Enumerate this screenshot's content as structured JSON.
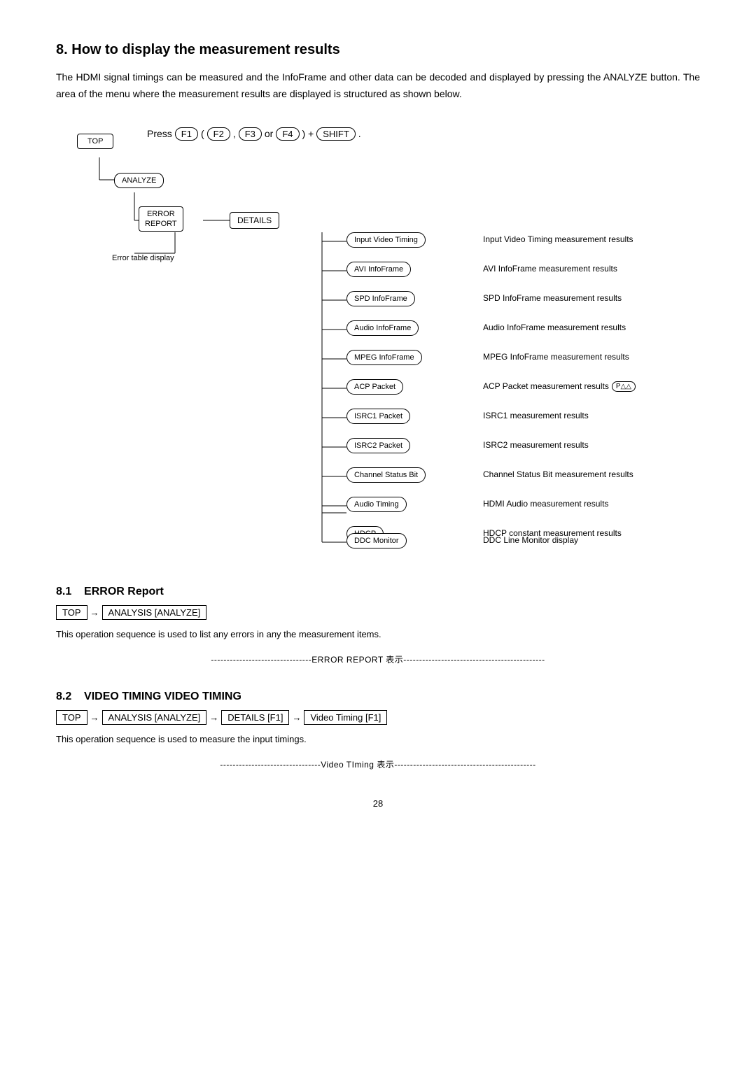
{
  "page": {
    "section_number": "8.",
    "section_title": "How to display the measurement results",
    "intro_text": "The HDMI signal timings can be measured and the InfoFrame and other data can be decoded and displayed by pressing the ANALYZE button.  The area of the menu where the measurement results are displayed is structured as shown below.",
    "diagram": {
      "press_label": "Press",
      "keys": [
        "F1",
        "F2",
        "F3",
        "F4",
        "SHIFT"
      ],
      "key_separators": [
        "(",
        ",",
        "(",
        "or",
        ")++("
      ],
      "nodes": {
        "top": "TOP",
        "analyze": "ANALYZE",
        "error_report": "ERROR\nREPORT",
        "details": "DETAILS",
        "error_table": "Error table display",
        "items": [
          {
            "label": "Input Video Timing",
            "desc": "Input Video Timing measurement results"
          },
          {
            "label": "AVI InfoFrame",
            "desc": "AVI InfoFrame measurement results"
          },
          {
            "label": "SPD InfoFrame",
            "desc": "SPD InfoFrame measurement results"
          },
          {
            "label": "Audio InfoFrame",
            "desc": "Audio InfoFrame measurement results"
          },
          {
            "label": "MPEG InfoFrame",
            "desc": "MPEG InfoFrame measurement results"
          },
          {
            "label": "ACP Packet",
            "desc": "ACP Packet measurement results",
            "badge": "P△△"
          },
          {
            "label": "ISRC1 Packet",
            "desc": "ISRC1 measurement results"
          },
          {
            "label": "ISRC2 Packet",
            "desc": "ISRC2 measurement results"
          },
          {
            "label": "Channel Status Bit",
            "desc": "Channel Status Bit measurement results"
          },
          {
            "label": "Audio Timing",
            "desc": "HDMI Audio measurement results"
          },
          {
            "label": "HDCP",
            "desc": "HDCP constant measurement results"
          },
          {
            "label": "DDC Monitor",
            "desc": "DDC Line Monitor display"
          }
        ]
      }
    },
    "subsections": [
      {
        "number": "8.1",
        "title": "ERROR Report",
        "breadcrumb": [
          "TOP",
          "ANALYSIS [ANALYZE]"
        ],
        "operation_text": "This operation sequence is used to list any errors in any the measurement items.",
        "separator": "--------------------------------ERROR REPORT 表示---------------------------------------------"
      },
      {
        "number": "8.2",
        "title": "VIDEO TIMING VIDEO TIMING",
        "breadcrumb": [
          "TOP",
          "ANALYSIS [ANALYZE]",
          "DETAILS [F1]",
          "Video Timing [F1]"
        ],
        "operation_text": "This operation sequence is used to measure the input timings.",
        "separator": "--------------------------------Video TIming 表示---------------------------------------------"
      }
    ],
    "page_number": "28"
  }
}
